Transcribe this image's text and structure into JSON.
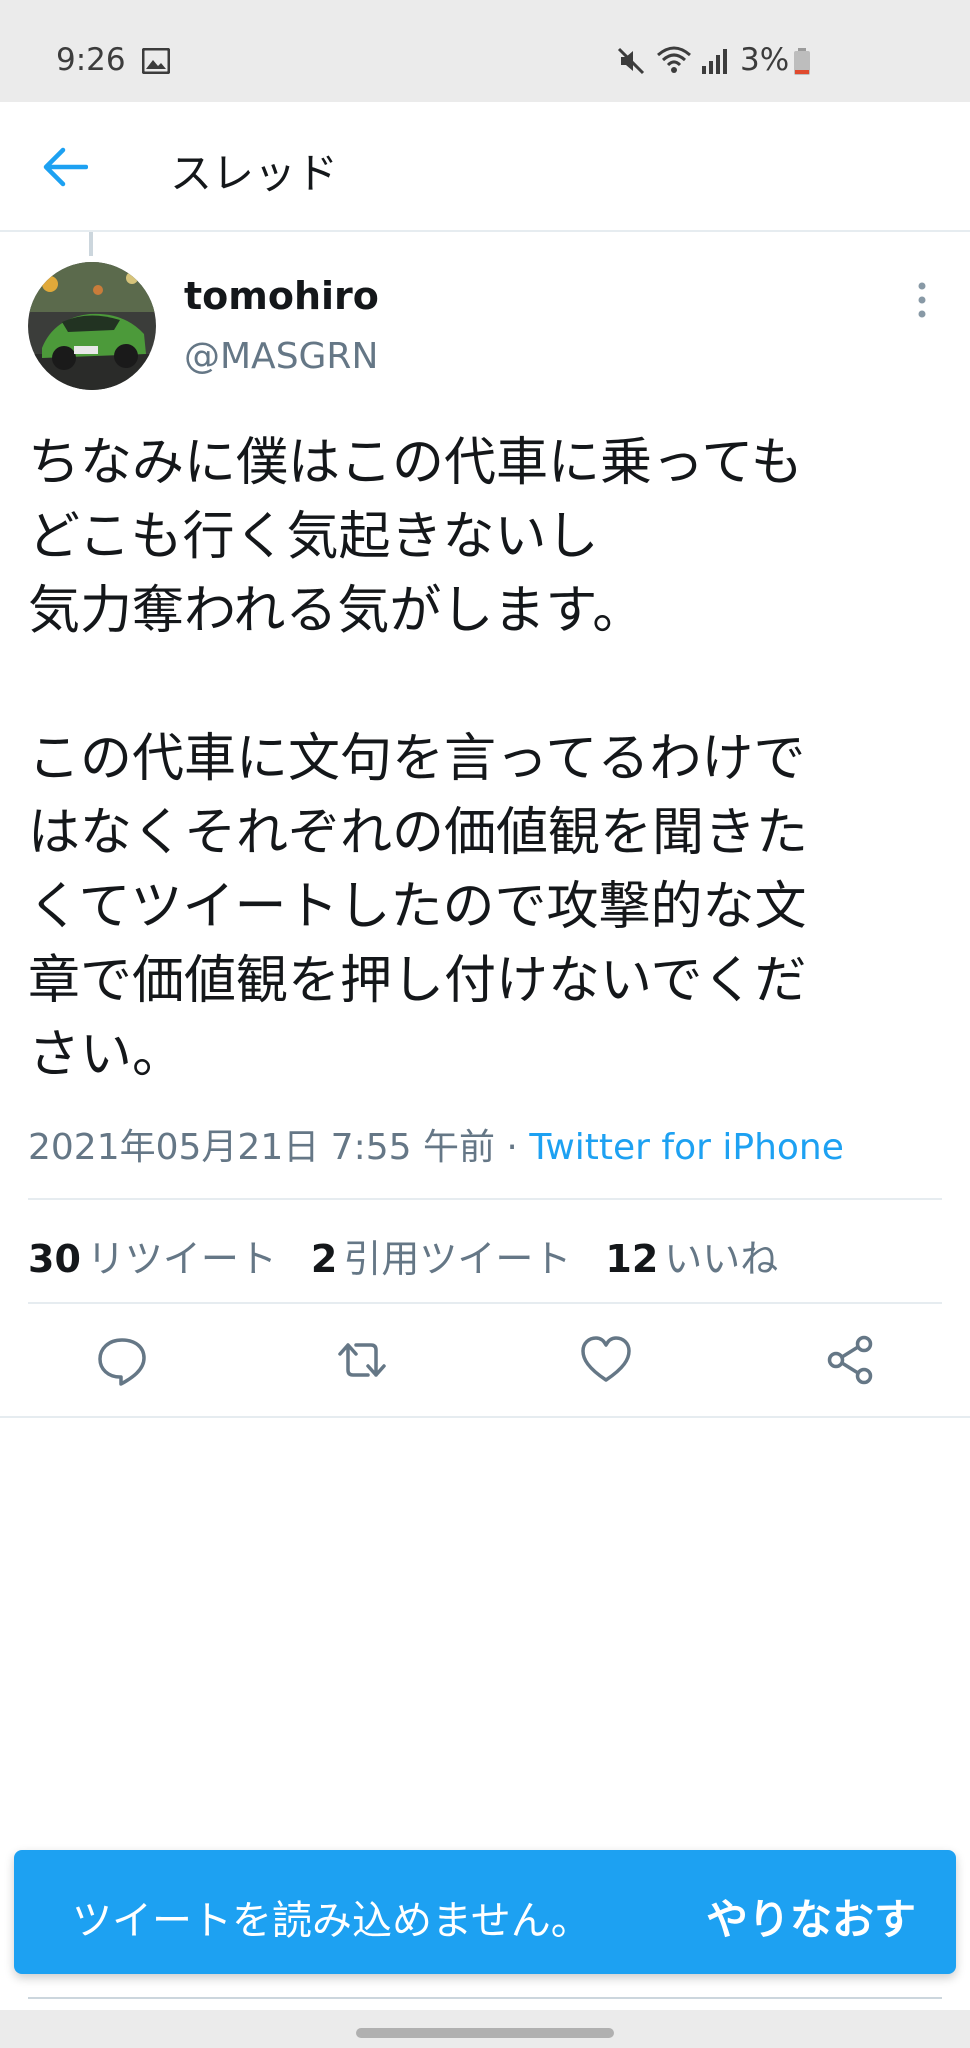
{
  "status_bar": {
    "time": "9:26",
    "battery": "3%",
    "icons": [
      "image-icon",
      "mute-icon",
      "wifi-icon",
      "signal-icon",
      "battery-icon"
    ]
  },
  "header": {
    "title": "スレッド",
    "back_icon": "arrow-left-icon"
  },
  "tweet": {
    "name": "tomohiro",
    "handle": "@MASGRN",
    "text": "ちなみに僕はこの代車に乗っても\nどこも行く気起きないし\n気力奪われる気がします。\n\nこの代車に文句を言ってるわけで\nはなくそれぞれの価値観を聞きた\nくてツイートしたので攻撃的な文\n章で価値観を押し付けないでくだ\nさい。",
    "timestamp": "2021年05月21日 7:55 午前",
    "separator": "·",
    "source": "Twitter for iPhone",
    "stats": {
      "retweets": {
        "count": "30",
        "label": "リツイート"
      },
      "quotes": {
        "count": "2",
        "label": "引用ツイート"
      },
      "likes": {
        "count": "12",
        "label": "いいね"
      }
    }
  },
  "actions": [
    "reply-icon",
    "retweet-icon",
    "like-icon",
    "share-icon"
  ],
  "toast": {
    "message": "ツイートを読み込めません。",
    "retry": "やりなおす"
  },
  "colors": {
    "accent": "#1da1f2",
    "secondary_text": "#657786",
    "primary_text": "#14171a",
    "divider": "#e6ecf0"
  }
}
